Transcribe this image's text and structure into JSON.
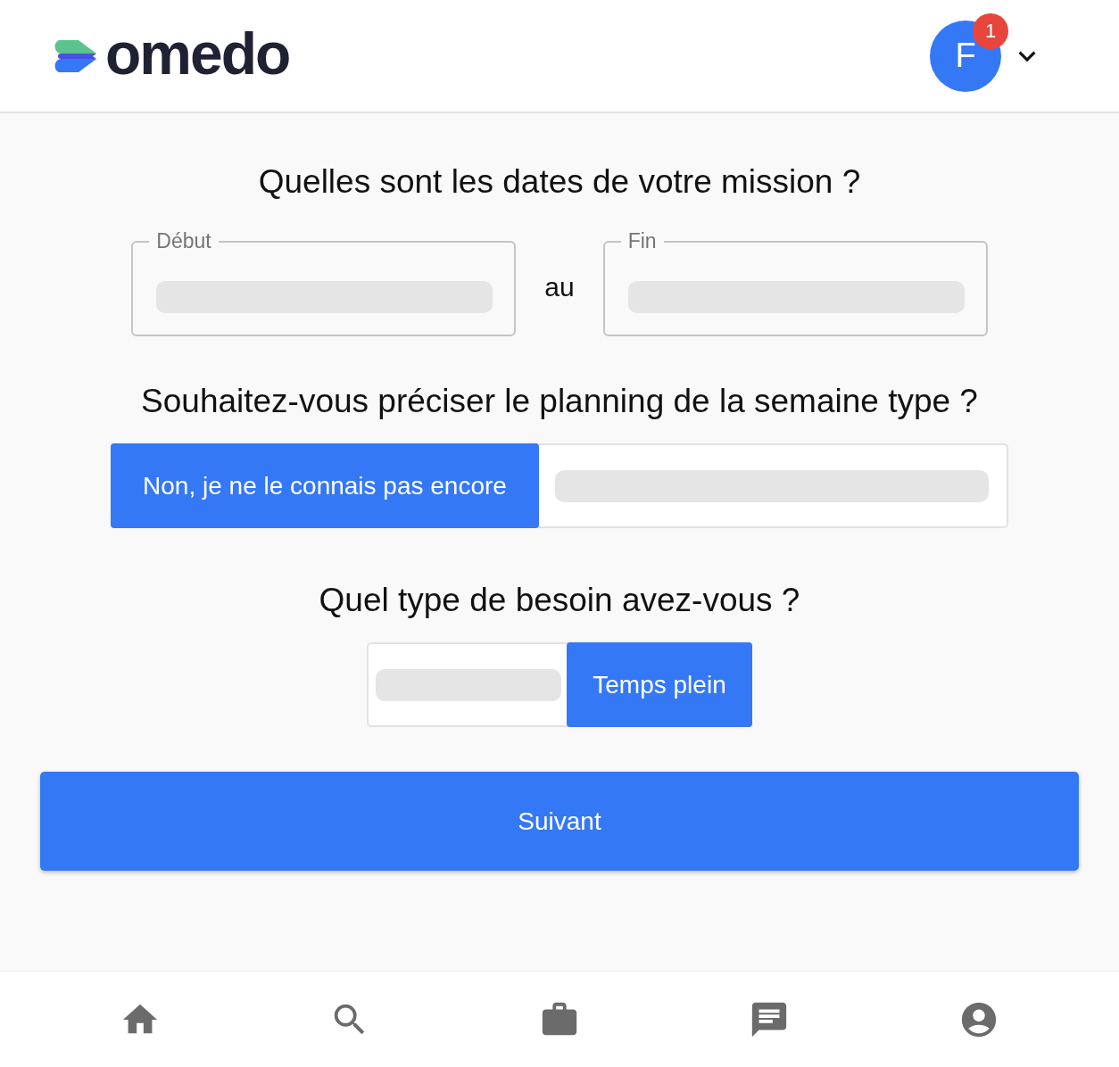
{
  "header": {
    "logo": "omedo",
    "avatar": {
      "initial": "F",
      "badge": "1"
    }
  },
  "dates": {
    "title": "Quelles sont les dates de votre mission ?",
    "separator": "au",
    "fields": [
      {
        "label": "Début",
        "loading": true
      },
      {
        "label": "Fin",
        "loading": true
      }
    ]
  },
  "planning": {
    "title": "Souhaitez-vous préciser le planning de la semaine type ?",
    "options": [
      {
        "kind": "text",
        "label": "Non, je ne le connais pas encore",
        "selected": true
      },
      {
        "kind": "skeleton",
        "selected": false
      }
    ]
  },
  "need": {
    "title": "Quel type de besoin avez-vous ?",
    "options": [
      {
        "kind": "skeleton",
        "selected": false
      },
      {
        "kind": "text",
        "label": "Temps plein",
        "selected": true
      }
    ]
  },
  "next_button": "Suivant",
  "bottom_nav": [
    {
      "kind": "home"
    },
    {
      "kind": "search"
    },
    {
      "kind": "briefcase"
    },
    {
      "kind": "chat"
    },
    {
      "kind": "account"
    }
  ]
}
